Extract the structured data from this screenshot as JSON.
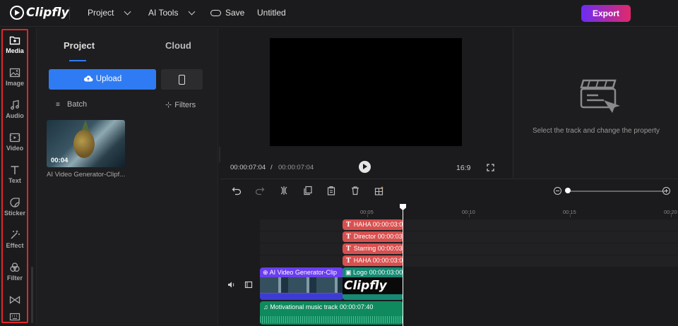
{
  "app": {
    "logo_text": "Clipfly"
  },
  "topbar": {
    "project_menu": "Project",
    "ai_tools_menu": "AI Tools",
    "save_label": "Save",
    "doc_title": "Untitled",
    "export_label": "Export"
  },
  "sidebar": {
    "items": [
      {
        "label": "Media",
        "icon": "folder-plus-icon"
      },
      {
        "label": "Image",
        "icon": "image-icon"
      },
      {
        "label": "Audio",
        "icon": "music-note-icon"
      },
      {
        "label": "Video",
        "icon": "film-icon"
      },
      {
        "label": "Text",
        "icon": "text-icon"
      },
      {
        "label": "Sticker",
        "icon": "sticker-icon"
      },
      {
        "label": "Effect",
        "icon": "magic-wand-icon"
      },
      {
        "label": "Filter",
        "icon": "filter-circles-icon"
      },
      {
        "label": "",
        "icon": "transition-icon"
      },
      {
        "label": "",
        "icon": "keyboard-icon"
      }
    ],
    "highlight_color": "#e0262a"
  },
  "media_panel": {
    "tabs": [
      "Project",
      "Cloud"
    ],
    "upload_label": "Upload",
    "batch_label": "Batch",
    "filters_label": "Filters",
    "asset": {
      "name": "AI Video Generator-Clipf...",
      "duration": "00:04"
    },
    "accent": "#2f7bf3"
  },
  "preview": {
    "current_time": "00:00:07:04",
    "separator": "/",
    "total_time": "00:00:07:04",
    "aspect_ratio": "16:9"
  },
  "properties": {
    "hint": "Select the track and change the property"
  },
  "timeline": {
    "ruler_labels": [
      "00:05",
      "00:10",
      "00:15",
      "00:20"
    ],
    "text_clips": [
      {
        "label": "HAHA",
        "time": "00:00:03:0"
      },
      {
        "label": "Director",
        "time": "00:00:03"
      },
      {
        "label": "Starring",
        "time": "00:00:03"
      },
      {
        "label": "HAHA",
        "time": "00:00:03:0"
      }
    ],
    "video_clip": {
      "label": "AI Video Generator-Clip"
    },
    "logo_clip": {
      "label": "Logo",
      "time": "00:00:03:00",
      "preview_text": "Clipfly"
    },
    "audio_clip": {
      "label": "Motivational music track",
      "time": "00:00:07:40"
    }
  }
}
